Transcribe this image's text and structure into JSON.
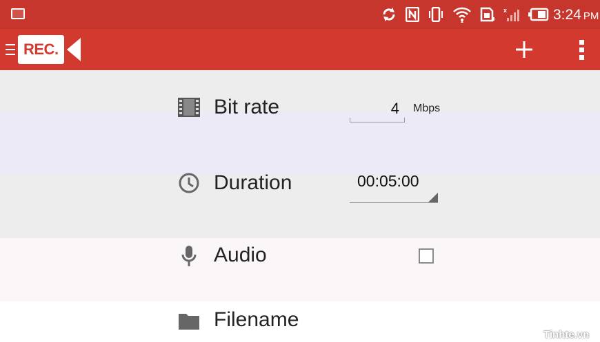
{
  "status_bar": {
    "time": "3:24",
    "ampm": "PM",
    "icons": [
      "gallery-icon",
      "sync-icon",
      "nfc-icon",
      "vibrate-icon",
      "wifi-icon",
      "sim-icon",
      "signal-icon",
      "battery-icon"
    ]
  },
  "app_bar": {
    "logo_text": "REC.",
    "actions": [
      "add-icon",
      "overflow-menu-icon"
    ]
  },
  "settings": {
    "bit_rate": {
      "label": "Bit rate",
      "value": "4",
      "unit": "Mbps",
      "icon": "film-icon"
    },
    "duration": {
      "label": "Duration",
      "value": "00:05:00",
      "icon": "clock-icon"
    },
    "audio": {
      "label": "Audio",
      "checked": false,
      "icon": "microphone-icon"
    },
    "filename": {
      "label": "Filename",
      "icon": "folder-icon"
    }
  },
  "watermark": "Tinhte.vn",
  "colors": {
    "status_bar": "#c7362c",
    "app_bar": "#d23a2f",
    "band_gray": "#ededed",
    "band_lavender": "#eceaf7",
    "band_pink": "#fbf7f8"
  }
}
